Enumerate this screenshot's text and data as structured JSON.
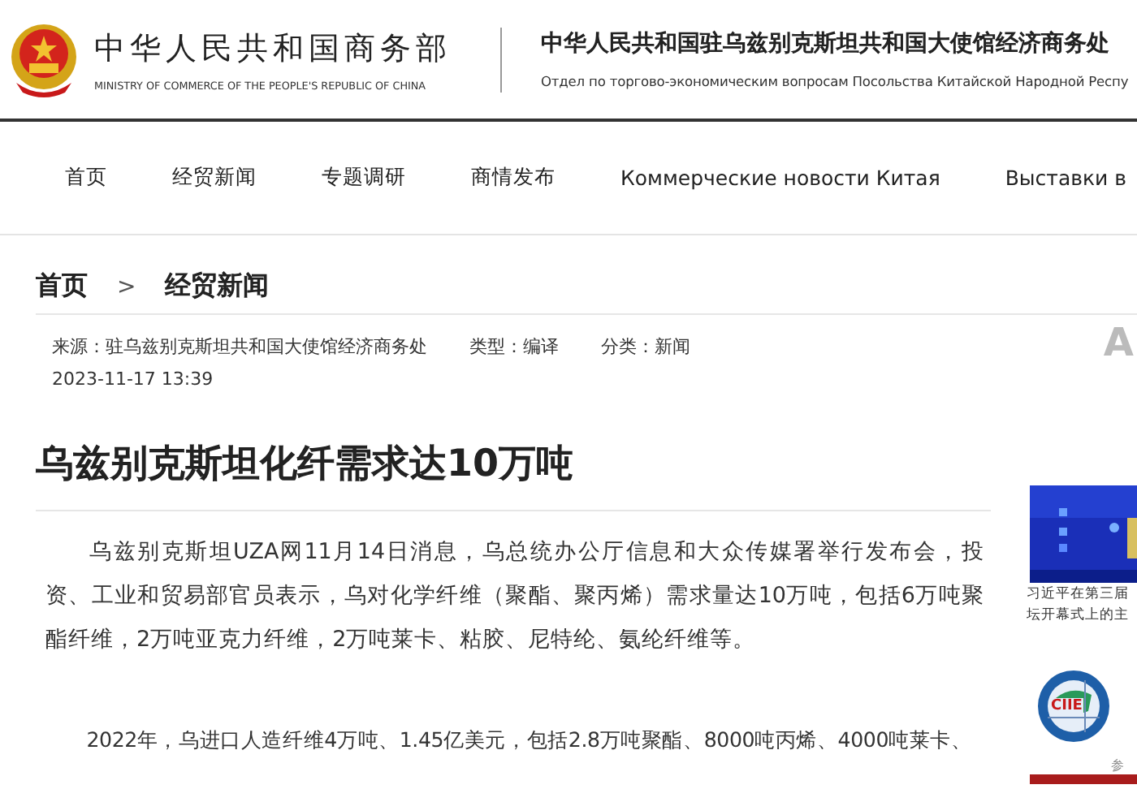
{
  "header": {
    "ministry_name": "中华人民共和国商务部",
    "ministry_name_en": "MINISTRY OF COMMERCE OF THE PEOPLE'S REPUBLIC OF CHINA",
    "office_title": "中华人民共和国驻乌兹别克斯坦共和国大使馆经济商务处",
    "office_subtitle": "Отдел по торгово-экономическим вопросам Посольства Китайской Народной Респу"
  },
  "nav": [
    {
      "label": "首页"
    },
    {
      "label": "经贸新闻"
    },
    {
      "label": "专题调研"
    },
    {
      "label": "商情发布"
    },
    {
      "label": "Коммерческие новости Китая"
    },
    {
      "label": "Выставки в"
    }
  ],
  "breadcrumb": [
    {
      "label": "首页"
    },
    {
      "label": "经贸新闻"
    }
  ],
  "breadcrumb_separator": ">",
  "meta": {
    "source": "来源：驻乌兹别克斯坦共和国大使馆经济商务处",
    "type": "类型：编译",
    "category": "分类：新闻",
    "date": "2023-11-17 13:39"
  },
  "edge_letter": "A",
  "article": {
    "title": "乌兹别克斯坦化纤需求达10万吨",
    "paragraphs": [
      "乌兹别克斯坦UZA网11月14日消息，乌总统办公厅信息和大众传媒署举行发布会，投资、工业和贸易部官员表示，乌对化学纤维（聚酯、聚丙烯）需求量达10万吨，包括6万吨聚酯纤维，2万吨亚克力纤维，2万吨莱卡、粘胶、尼特纶、氨纶纤维等。",
      "2022年，乌进口人造纤维4万吨、1.45亿美元，包括2.8万吨聚酯、8000吨丙烯、4000吨莱卡、"
    ]
  },
  "sidebar": {
    "caption_lines": [
      "习近平在第三届",
      "坛开幕式上的主"
    ],
    "logo_text": "CIIE",
    "logo_note": "参"
  }
}
